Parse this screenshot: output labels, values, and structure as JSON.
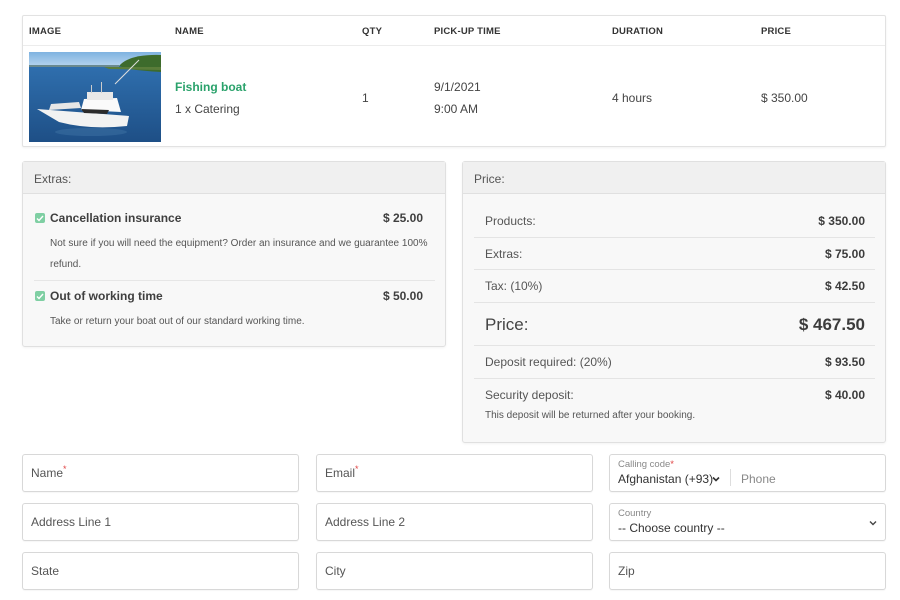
{
  "order_table": {
    "headers": [
      "IMAGE",
      "NAME",
      "QTY",
      "PICK-UP TIME",
      "DURATION",
      "PRICE"
    ],
    "rows": [
      {
        "image_alt": "boat-photo",
        "name": "Fishing boat",
        "extras_line": "1 x Catering",
        "qty": "1",
        "pickup_date": "9/1/2021",
        "pickup_time": "9:00 AM",
        "duration": "4 hours",
        "price": "$ 350.00"
      }
    ]
  },
  "extras": {
    "title": "Extras:",
    "items": [
      {
        "checked": true,
        "name": "Cancellation insurance",
        "price": "$ 25.00",
        "description": "Not sure if you will need the equipment? Order an insurance and we guarantee 100% refund."
      },
      {
        "checked": true,
        "name": "Out of working time",
        "price": "$ 50.00",
        "description": "Take or return your boat out of our standard working time."
      }
    ]
  },
  "price": {
    "title": "Price:",
    "rows": [
      {
        "label": "Products:",
        "value": "$ 350.00"
      },
      {
        "label": "Extras:",
        "value": "$ 75.00"
      },
      {
        "label": "Tax: (10%)",
        "value": "$ 42.50"
      },
      {
        "label": "Price:",
        "value": "$ 467.50"
      },
      {
        "label": "Deposit required: (20%)",
        "value": "$ 93.50"
      },
      {
        "label": "Security deposit:",
        "value": "$ 40.00"
      }
    ],
    "security_note": "This deposit will be returned after your booking."
  },
  "form": {
    "name": {
      "placeholder": "Name",
      "required": "*"
    },
    "email": {
      "placeholder": "Email",
      "required": "*"
    },
    "calling_code": {
      "label": "Calling code",
      "required": "*",
      "value": "Afghanistan (+93)"
    },
    "phone": {
      "placeholder": "Phone"
    },
    "address1": {
      "placeholder": "Address Line 1"
    },
    "address2": {
      "placeholder": "Address Line 2"
    },
    "country": {
      "label": "Country",
      "value": "-- Choose country --"
    },
    "state": {
      "placeholder": "State"
    },
    "city": {
      "placeholder": "City"
    },
    "zip": {
      "placeholder": "Zip"
    }
  },
  "colors": {
    "accent_green": "#2aa26b",
    "checkbox_green": "#7fcfa3",
    "required_red": "#e04444"
  }
}
